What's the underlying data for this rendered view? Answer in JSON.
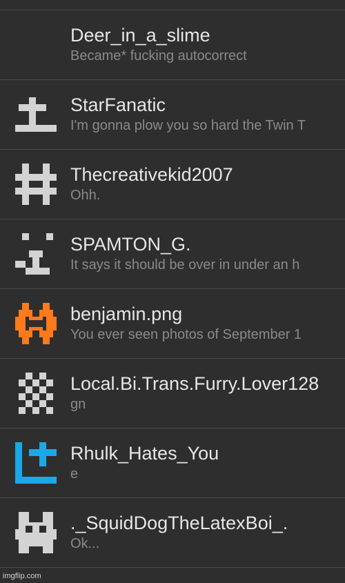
{
  "conversations": [
    {
      "username": "Deer_in_a_slime",
      "last_message": "Became* fucking autocorrect",
      "avatar_icon": "none",
      "avatar_color": ""
    },
    {
      "username": "StarFanatic",
      "last_message": "I'm gonna plow you so hard the Twin T",
      "avatar_icon": "pixel-avatar-cross-icon",
      "avatar_color": "#d3d3d3"
    },
    {
      "username": "Thecreativekid2007",
      "last_message": "Ohh.",
      "avatar_icon": "pixel-avatar-hash-icon",
      "avatar_color": "#d3d3d3"
    },
    {
      "username": "SPAMTON_G.",
      "last_message": "It says it should be over in under an h",
      "avatar_icon": "pixel-avatar-face-icon",
      "avatar_color": "#d3d3d3"
    },
    {
      "username": "benjamin.png",
      "last_message": "You ever seen photos of September 1",
      "avatar_icon": "pixel-avatar-orange-icon",
      "avatar_color": "#ff7a1a"
    },
    {
      "username": "Local.Bi.Trans.Furry.Lover128",
      "last_message": "gn",
      "avatar_icon": "pixel-avatar-checker-icon",
      "avatar_color": "#d3d3d3"
    },
    {
      "username": "Rhulk_Hates_You",
      "last_message": "e",
      "avatar_icon": "pixel-avatar-blue-plus-icon",
      "avatar_color": "#1aa9e6"
    },
    {
      "username": "._SquidDogTheLatexBoi_.",
      "last_message": "Ok...",
      "avatar_icon": "pixel-avatar-creature-icon",
      "avatar_color": "#d3d3d3"
    }
  ],
  "watermark": "imgflip.com",
  "colors": {
    "background": "#2e2e2e",
    "divider": "#4a4a4a",
    "username": "#e6e6e6",
    "message": "#8a8a8a"
  }
}
